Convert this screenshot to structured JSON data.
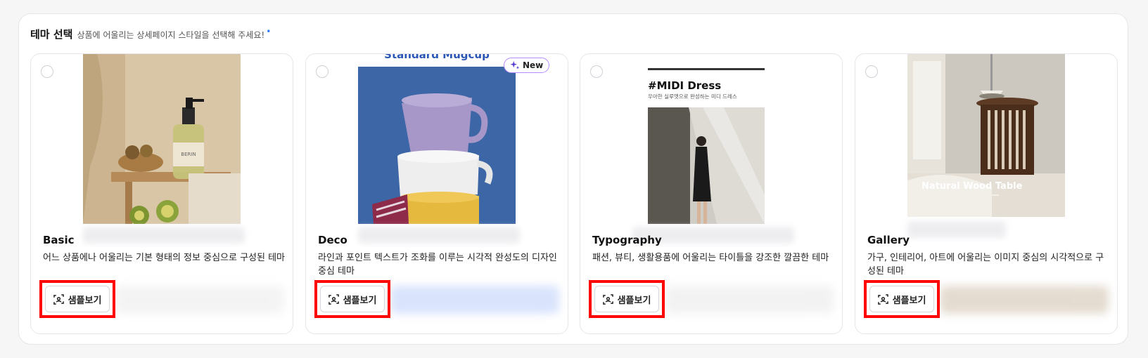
{
  "header": {
    "title": "테마 선택",
    "subtitle": "상품에 어울리는 상세페이지 스타일을 선택해 주세요!",
    "required_mark": "•"
  },
  "cards": [
    {
      "name": "Basic",
      "description": "어느 상품에나 어울리는 기본 형태의 정보 중심으로 구성된 테마",
      "sample_label": "샘플보기",
      "thumb_text": "BERIN"
    },
    {
      "name": "Deco",
      "description": "라인과 포인트 텍스트가 조화를 이루는 시각적 완성도의 디자인 중심 테마",
      "sample_label": "샘플보기",
      "badge": "New",
      "thumb_text": "Standard Mugcup"
    },
    {
      "name": "Typography",
      "description": "패션, 뷰티, 생활용품에 어울리는 타이틀을 강조한 깔끔한 테마",
      "sample_label": "샘플보기",
      "thumb_title": "#MIDI Dress",
      "thumb_subtitle": "우아한 실루엣으로 완성하는 미디 드레스"
    },
    {
      "name": "Gallery",
      "description": "가구, 인테리어, 아트에 어울리는 이미지 중심의 시각적으로 구성된 테마",
      "sample_label": "샘플보기",
      "thumb_title": "Natural Wood Table"
    }
  ],
  "icons": {
    "radio": "radio-unselected-icon",
    "sample": "scan-frame-icon",
    "badge": "sparkle-icon"
  },
  "colors": {
    "highlight": "#ff0000",
    "accent": "#2f7bff",
    "badge_border": "#b48cff"
  }
}
